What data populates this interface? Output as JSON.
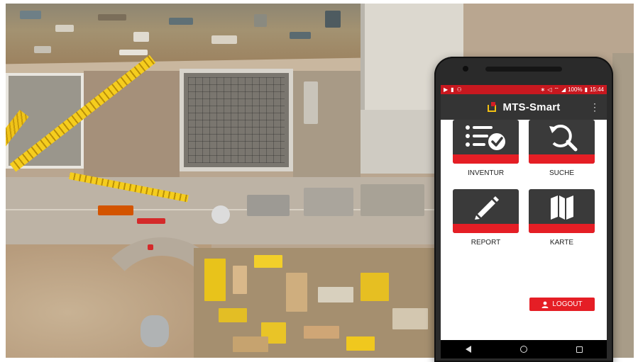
{
  "status_bar": {
    "left_icons": [
      "play-store-icon",
      "notification-icon",
      "android-debug-icon"
    ],
    "right_icons": [
      "bluetooth-icon",
      "mute-icon",
      "wifi-icon",
      "signal-icon"
    ],
    "battery": "100%",
    "time": "15:44"
  },
  "app": {
    "title": "MTS-Smart",
    "menu_icon": "overflow-menu-icon",
    "logo_colors": [
      "#f2c013",
      "#d41e25"
    ]
  },
  "tiles": [
    {
      "label": "INVENTUR",
      "icon": "checklist-icon"
    },
    {
      "label": "SUCHE",
      "icon": "search-refresh-icon"
    },
    {
      "label": "REPORT",
      "icon": "pencil-icon"
    },
    {
      "label": "KARTE",
      "icon": "map-icon"
    }
  ],
  "logout": {
    "label": "LOGOUT",
    "icon": "person-icon"
  },
  "nav": [
    "back-icon",
    "home-icon",
    "recent-apps-icon"
  ],
  "colors": {
    "accent_red": "#e51e25",
    "status_bar_red": "#c8181f",
    "appbar_dark": "#343434",
    "tile_dark": "#3a3a3a"
  }
}
